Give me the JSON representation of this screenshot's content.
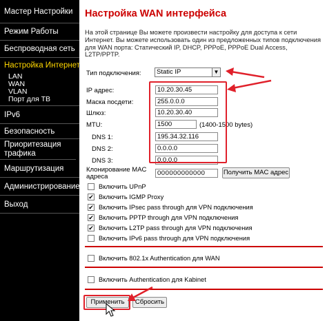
{
  "sidebar": {
    "items": [
      {
        "label": "Мастер Настройки"
      },
      {
        "label": "Режим Работы"
      },
      {
        "label": "Беспроводная сеть"
      },
      {
        "label": "Настройка Интернет"
      },
      {
        "label": "IPv6"
      },
      {
        "label": "Безопасность"
      },
      {
        "label": "Приоритезация трафика"
      },
      {
        "label": "Маршрутизация"
      },
      {
        "label": "Администрирование"
      },
      {
        "label": "Выход"
      }
    ],
    "subitems": [
      "LAN",
      "WAN",
      "VLAN",
      "Порт для ТВ"
    ],
    "active_color": "#ffd700"
  },
  "page": {
    "title": "Настройка WAN интерфейса",
    "description": "На этой странице Вы можете произвести настройку для доступа к сети Интернет. Вы можете использовать один из предложенных типов подключения для WAN порта: Статический IP, DHCP, PPPoE, PPPoE Dual Access, L2TP/PPTP."
  },
  "form": {
    "connection_type_label": "Тип подключения:",
    "connection_type_value": "Static IP",
    "ip_label": "IP адрес:",
    "ip_value": "10.20.30.45",
    "mask_label": "Маска посдети:",
    "mask_value": "255.0.0.0",
    "gateway_label": "Шлюз:",
    "gateway_value": "10.20.30.40",
    "mtu_label": "MTU:",
    "mtu_value": "1500",
    "mtu_hint": "(1400-1500 bytes)",
    "dns1_label": "DNS 1:",
    "dns1_value": "195.34.32.116",
    "dns2_label": "DNS 2:",
    "dns2_value": "0.0.0.0",
    "dns3_label": "DNS 3:",
    "dns3_value": "0.0.0.0",
    "mac_clone_label_1": "Клонирование MAC",
    "mac_clone_label_2": "адреса",
    "mac_value": "000000000000",
    "get_mac_button": "Получить MAC адрес"
  },
  "options": [
    {
      "label": "Включить UPnP",
      "checked": false
    },
    {
      "label": "Включить IGMP Proxy",
      "checked": true
    },
    {
      "label": "Включить IPsec pass through для VPN подключения",
      "checked": true
    },
    {
      "label": "Включить PPTP through для VPN подключения",
      "checked": true
    },
    {
      "label": "Включить L2TP pass through для VPN подключения",
      "checked": true
    },
    {
      "label": "Включить IPv6 pass through для VPN подключения",
      "checked": false
    }
  ],
  "auth_8021x": {
    "label": "Включить 802.1x Authentication для WAN",
    "checked": false
  },
  "auth_kabinet": {
    "label": "Включить Authentication для Kabinet",
    "checked": false
  },
  "buttons": {
    "apply": "Применить",
    "reset": "Сбросить"
  },
  "colors": {
    "accent_red": "#cc0000",
    "annotation_red": "#e0202a"
  }
}
